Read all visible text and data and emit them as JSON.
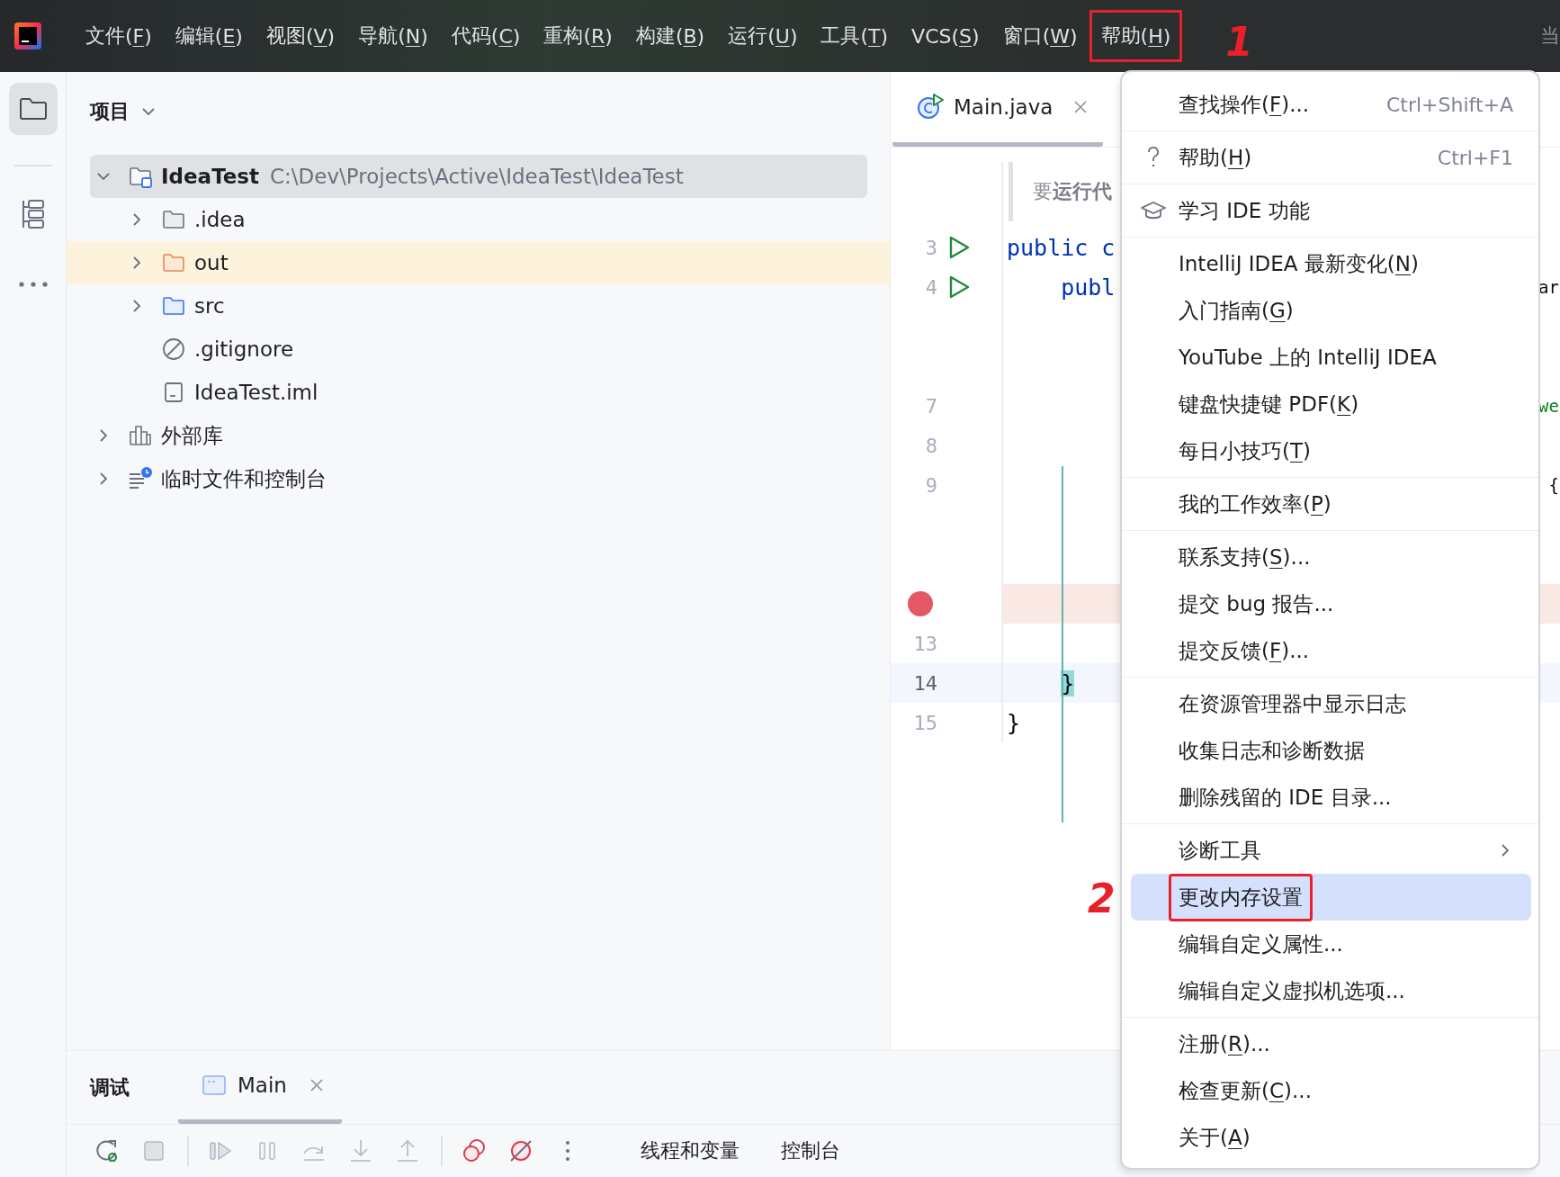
{
  "menu_bar": {
    "items": [
      {
        "label": "文件(",
        "key": "F",
        "after": ")"
      },
      {
        "label": "编辑(",
        "key": "E",
        "after": ")"
      },
      {
        "label": "视图(",
        "key": "V",
        "after": ")"
      },
      {
        "label": "导航(",
        "key": "N",
        "after": ")"
      },
      {
        "label": "代码(",
        "key": "C",
        "after": ")"
      },
      {
        "label": "重构(",
        "key": "R",
        "after": ")"
      },
      {
        "label": "构建(",
        "key": "B",
        "after": ")"
      },
      {
        "label": "运行(",
        "key": "U",
        "after": ")"
      },
      {
        "label": "工具(",
        "key": "T",
        "after": ")"
      },
      {
        "label": "VCS(",
        "key": "S",
        "after": ")"
      },
      {
        "label": "窗口(",
        "key": "W",
        "after": ")"
      },
      {
        "label": "帮助(",
        "key": "H",
        "after": ")",
        "annotation": "1"
      }
    ],
    "right_text": "当"
  },
  "project": {
    "title": "项目",
    "tree": [
      {
        "name": "IdeaTest",
        "path": "C:\\Dev\\Projects\\Active\\IdeaTest\\IdeaTest",
        "kind": "module",
        "expanded": true,
        "selected": true,
        "children": [
          {
            "name": ".idea",
            "kind": "folder",
            "expanded": false,
            "selected": false
          },
          {
            "name": "out",
            "kind": "excluded-folder",
            "expanded": false,
            "selected": false
          },
          {
            "name": "src",
            "kind": "source-folder",
            "expanded": false,
            "selected": false
          },
          {
            "name": ".gitignore",
            "kind": "ignore-file",
            "selected": false
          },
          {
            "name": "IdeaTest.iml",
            "kind": "module-file",
            "selected": false
          }
        ]
      },
      {
        "name": "外部库",
        "kind": "library",
        "expanded": false,
        "selected": false
      },
      {
        "name": "临时文件和控制台",
        "kind": "scratches",
        "expanded": false,
        "selected": false
      }
    ]
  },
  "editor": {
    "tab": {
      "title": "Main.java",
      "selected": true
    },
    "rows": [
      {
        "kind": "hint",
        "text": "要**运行代**"
      },
      {
        "kind": "line",
        "number": "3",
        "run": true,
        "breakpoint": false,
        "current": false,
        "code": [
          {
            "text": "public c",
            "kind": "keyword"
          }
        ]
      },
      {
        "kind": "line",
        "number": "4",
        "run": true,
        "breakpoint": false,
        "current": false,
        "code": [
          {
            "text": "    publ",
            "kind": "keyword"
          }
        ],
        "tail": {
          "text": "ar",
          "kind": "plain"
        }
      },
      {
        "kind": "line",
        "run": false,
        "breakpoint": false,
        "current": false
      },
      {
        "kind": "line",
        "run": false,
        "breakpoint": false,
        "current": false
      },
      {
        "kind": "line",
        "number": "7",
        "run": false,
        "breakpoint": false,
        "current": false,
        "tail": {
          "text": "we",
          "kind": "string"
        }
      },
      {
        "kind": "line",
        "number": "8",
        "run": false,
        "breakpoint": false,
        "current": false
      },
      {
        "kind": "line",
        "number": "9",
        "run": false,
        "breakpoint": false,
        "current": false,
        "tail": {
          "text": "{",
          "kind": "plain"
        }
      },
      {
        "kind": "line",
        "run": false,
        "breakpoint": false,
        "current": false
      },
      {
        "kind": "line",
        "run": false,
        "breakpoint": false,
        "current": false
      },
      {
        "kind": "line",
        "run": false,
        "breakpoint": true,
        "current": false
      },
      {
        "kind": "line",
        "number": "13",
        "run": false,
        "breakpoint": false,
        "current": false
      },
      {
        "kind": "line",
        "number": "14",
        "run": false,
        "breakpoint": false,
        "current": true,
        "code": [
          {
            "text": "    }",
            "kind": "brace-match"
          }
        ]
      },
      {
        "kind": "line",
        "number": "15",
        "run": false,
        "breakpoint": false,
        "current": false,
        "code": [
          {
            "text": "}",
            "kind": "plain"
          }
        ]
      }
    ]
  },
  "help_menu": {
    "groups": [
      [
        {
          "kind": "plain",
          "label": "查找操作(",
          "key": "F",
          "after": ")...",
          "shortcut": "Ctrl+Shift+A",
          "selected": false
        }
      ],
      [
        {
          "kind": "question",
          "label": "帮助(",
          "key": "H",
          "after": ")",
          "shortcut": "Ctrl+F1",
          "selected": false
        }
      ],
      [
        {
          "kind": "graduation-cap",
          "label": "学习 IDE 功能",
          "selected": false
        }
      ],
      [
        {
          "kind": "plain",
          "label": "IntelliJ IDEA 最新变化(",
          "key": "N",
          "after": ")",
          "selected": false
        },
        {
          "kind": "plain",
          "label": "入门指南(",
          "key": "G",
          "after": ")",
          "selected": false
        },
        {
          "kind": "plain",
          "label": "YouTube 上的 IntelliJ IDEA",
          "selected": false
        },
        {
          "kind": "plain",
          "label": "键盘快捷键 PDF(",
          "key": "K",
          "after": ")",
          "selected": false
        },
        {
          "kind": "plain",
          "label": "每日小技巧(",
          "key": "T",
          "after": ")",
          "selected": false
        }
      ],
      [
        {
          "kind": "plain",
          "label": "我的工作效率(",
          "key": "P",
          "after": ")",
          "selected": false
        }
      ],
      [
        {
          "kind": "plain",
          "label": "联系支持(",
          "key": "S",
          "after": ")...",
          "selected": false
        },
        {
          "kind": "plain",
          "label": "提交 bug 报告...",
          "selected": false
        },
        {
          "kind": "plain",
          "label": "提交反馈(",
          "key": "F",
          "after": ")...",
          "selected": false
        }
      ],
      [
        {
          "kind": "plain",
          "label": "在资源管理器中显示日志",
          "selected": false
        },
        {
          "kind": "plain",
          "label": "收集日志和诊断数据",
          "selected": false
        },
        {
          "kind": "plain",
          "label": "删除残留的 IDE 目录...",
          "selected": false
        }
      ],
      [
        {
          "kind": "submenu",
          "label": "诊断工具",
          "selected": false
        },
        {
          "kind": "plain",
          "label": "更改内存设置",
          "selected": true,
          "annotation": "2"
        },
        {
          "kind": "plain",
          "label": "编辑自定义属性...",
          "selected": false
        },
        {
          "kind": "plain",
          "label": "编辑自定义虚拟机选项...",
          "selected": false
        }
      ],
      [
        {
          "kind": "plain",
          "label": "注册(",
          "key": "R",
          "after": ")...",
          "selected": false
        },
        {
          "kind": "plain",
          "label": "检查更新(",
          "key": "C",
          "after": ")...",
          "selected": false
        },
        {
          "kind": "plain",
          "label": "关于(",
          "key": "A",
          "after": ")",
          "selected": false
        }
      ]
    ]
  },
  "debug_panel": {
    "title": "调试",
    "tab": {
      "title": "Main",
      "selected": true
    },
    "toolbar": [
      {
        "kind": "rerun",
        "disabled": false
      },
      {
        "kind": "stop",
        "disabled": true
      },
      {
        "kind": "separator"
      },
      {
        "kind": "resume",
        "disabled": true
      },
      {
        "kind": "pause",
        "disabled": true
      },
      {
        "kind": "step-over",
        "disabled": true
      },
      {
        "kind": "step-into",
        "disabled": true
      },
      {
        "kind": "step-out",
        "disabled": true
      },
      {
        "kind": "separator"
      },
      {
        "kind": "view-breakpoints",
        "disabled": false
      },
      {
        "kind": "mute-breakpoints",
        "disabled": false
      },
      {
        "kind": "more",
        "disabled": false
      }
    ],
    "tabs": [
      {
        "title": "线程和变量",
        "selected": false
      },
      {
        "title": "控制台",
        "selected": false
      }
    ]
  }
}
